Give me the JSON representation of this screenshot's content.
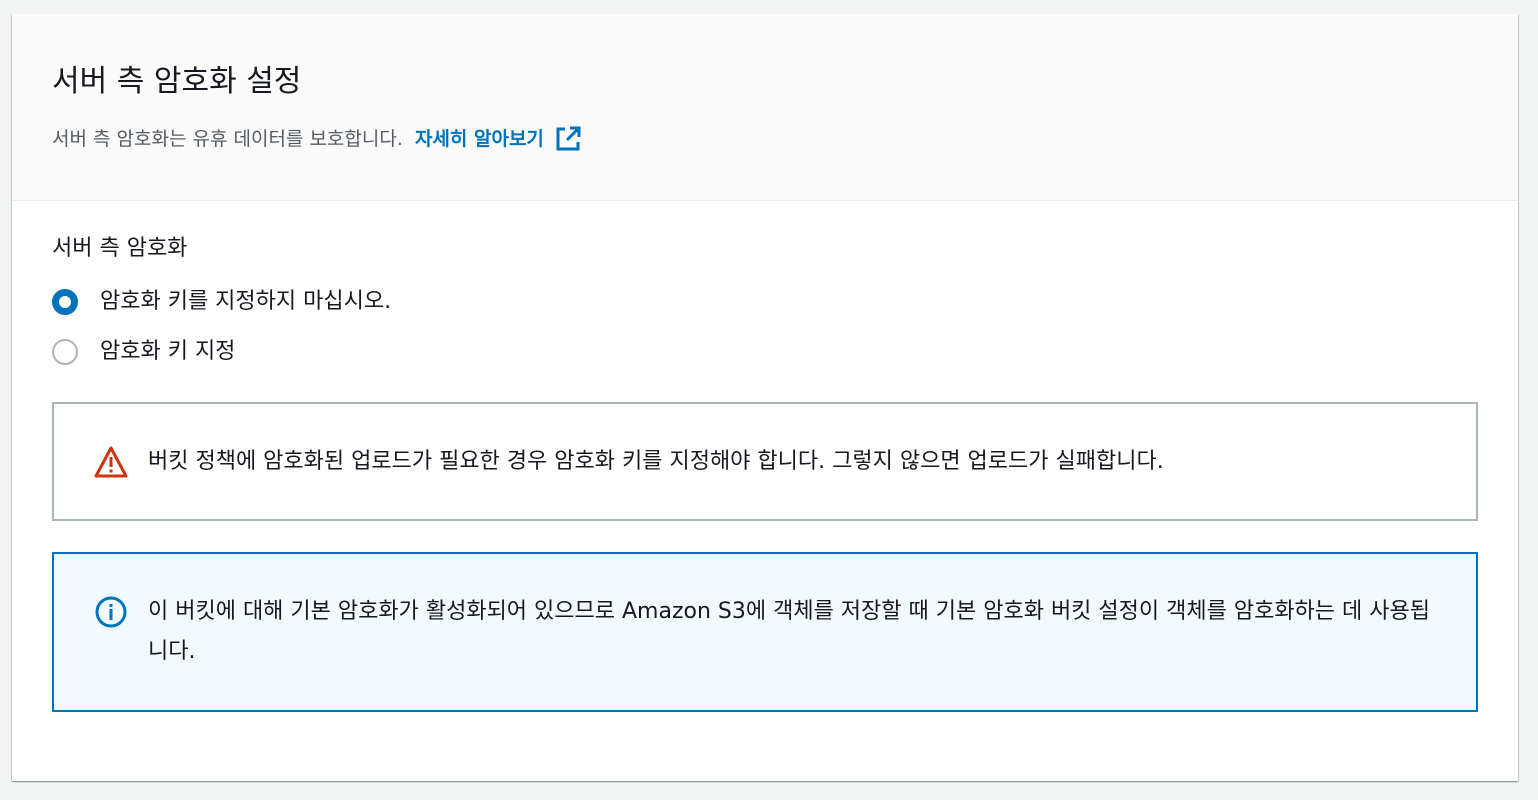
{
  "header": {
    "title": "서버 측 암호화 설정",
    "description": "서버 측 암호화는 유휴 데이터를 보호합니다.",
    "learn_more": "자세히 알아보기",
    "learn_more_icon": "external-link-icon"
  },
  "encryption": {
    "label": "서버 측 암호화",
    "options": [
      {
        "label": "암호화 키를 지정하지 마십시오.",
        "selected": true
      },
      {
        "label": "암호화 키 지정",
        "selected": false
      }
    ]
  },
  "warning": {
    "icon": "warning-icon",
    "text": "버킷 정책에 암호화된 업로드가 필요한 경우 암호화 키를 지정해야 합니다. 그렇지 않으면 업로드가 실패합니다."
  },
  "info": {
    "icon": "info-icon",
    "text": "이 버킷에 대해 기본 암호화가 활성화되어 있으므로 Amazon S3에 객체를 저장할 때 기본 암호화 버킷 설정이 객체를 암호화하는 데 사용됩니다."
  },
  "colors": {
    "link": "#0073bb",
    "warning": "#d13212",
    "info": "#0073bb",
    "info_bg": "#f1faff"
  }
}
